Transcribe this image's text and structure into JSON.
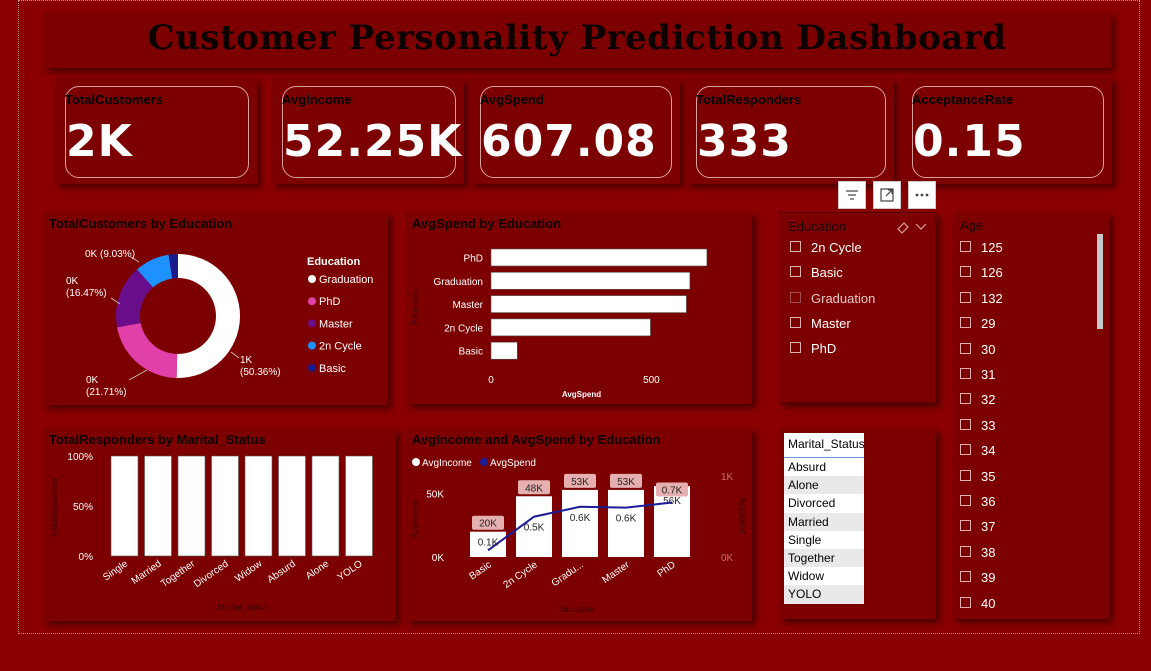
{
  "title": "Customer Personality Prediction Dashboard",
  "kpis": [
    {
      "label": "TotalCustomers",
      "value": "2K"
    },
    {
      "label": "AvgIncome",
      "value": "52.25K"
    },
    {
      "label": "AvgSpend",
      "value": "607.08"
    },
    {
      "label": "TotalResponders",
      "value": "333"
    },
    {
      "label": "AcceptanceRate",
      "value": "0.15"
    }
  ],
  "visual_header_icons": [
    "filter-icon",
    "focus-mode-icon",
    "more-options-icon"
  ],
  "education_slicer": {
    "title": "Education",
    "eraser_icon": "eraser-icon",
    "chevron_icon": "chevron-down-icon",
    "items": [
      "2n Cycle",
      "Basic",
      "Graduation",
      "Master",
      "PhD"
    ]
  },
  "age_slicer": {
    "title": "Age",
    "items": [
      "125",
      "126",
      "132",
      "29",
      "30",
      "31",
      "32",
      "33",
      "34",
      "35",
      "36",
      "37",
      "38",
      "39",
      "40"
    ]
  },
  "marital_table": {
    "header": "Marital_Status",
    "rows": [
      "Absurd",
      "Alone",
      "Divorced",
      "Married",
      "Single",
      "Together",
      "Widow",
      "YOLO"
    ]
  },
  "colors": {
    "background": "#8a0000",
    "panel": "#7d0000",
    "graduation": "#ffffff",
    "phd": "#e040a8",
    "master": "#6a0d8a",
    "2n_cycle": "#1e90ff",
    "basic": "#1a1a8c",
    "line": "#1c1c96"
  },
  "chart_data": [
    {
      "id": "donut",
      "type": "pie",
      "title": "TotalCustomers by Education",
      "legend_title": "Education",
      "legend_position": "right",
      "slices": [
        {
          "name": "Graduation",
          "percent": 50.36,
          "label": "1K (50.36%)"
        },
        {
          "name": "PhD",
          "percent": 21.71,
          "label": "0K (21.71%)"
        },
        {
          "name": "Master",
          "percent": 16.47,
          "label": "0K (16.47%)"
        },
        {
          "name": "2n Cycle",
          "percent": 9.03,
          "label": "0K (9.03%)"
        },
        {
          "name": "Basic",
          "percent": 2.43,
          "label": ""
        }
      ]
    },
    {
      "id": "hbar",
      "type": "bar",
      "orientation": "horizontal",
      "title": "AvgSpend by Education",
      "categories": [
        "PhD",
        "Graduation",
        "Master",
        "2n Cycle",
        "Basic"
      ],
      "values": [
        673,
        620,
        609,
        497,
        82
      ],
      "xlabel": "AvgSpend",
      "ylabel": "Education",
      "xlim": [
        0,
        720
      ],
      "xticks": [
        {
          "v": 0,
          "label": "0"
        },
        {
          "v": 500,
          "label": "500"
        }
      ]
    },
    {
      "id": "marital",
      "type": "bar",
      "title": "TotalResponders by Marital_Status",
      "categories": [
        "Single",
        "Married",
        "Together",
        "Divorced",
        "Widow",
        "Absurd",
        "Alone",
        "YOLO"
      ],
      "values": [
        100,
        100,
        100,
        100,
        100,
        100,
        100,
        100
      ],
      "ylim": [
        0,
        100
      ],
      "yticks": [
        {
          "v": 0,
          "label": "0%"
        },
        {
          "v": 50,
          "label": "50%"
        },
        {
          "v": 100,
          "label": "100%"
        }
      ],
      "xlabel": "Marital_Status",
      "ylabel": "TotalResponders"
    },
    {
      "id": "combo",
      "type": "bar",
      "title": "AvgIncome and AvgSpend by Education",
      "categories": [
        "Basic",
        "2n Cycle",
        "Graduation",
        "Master",
        "PhD"
      ],
      "tick_labels": [
        "Basic",
        "2n Cycle",
        "Gradu...",
        "Master",
        "PhD"
      ],
      "series": [
        {
          "name": "AvgIncome",
          "kind": "bar",
          "values": [
            20000,
            48000,
            53000,
            53000,
            56000
          ],
          "labels": [
            "20K",
            "48K",
            "53K",
            "53K",
            "56K"
          ]
        },
        {
          "name": "AvgSpend",
          "kind": "line",
          "values": [
            82,
            497,
            620,
            609,
            673
          ],
          "labels": [
            "0.1K",
            "0.5K",
            "0.6K",
            "0.6K",
            "0.7K"
          ]
        }
      ],
      "ylim_left": [
        0,
        64000
      ],
      "yticks_left": [
        {
          "v": 0,
          "label": "0K"
        },
        {
          "v": 50000,
          "label": "50K"
        }
      ],
      "ylim_right": [
        0,
        1000
      ],
      "yticks_right": [
        {
          "v": 0,
          "label": "0K"
        },
        {
          "v": 1000,
          "label": "1K"
        }
      ],
      "xlabel": "Education",
      "ylabel_left": "AvgIncome",
      "ylabel_right": "AvgSpend",
      "legend_position": "top-left"
    }
  ]
}
